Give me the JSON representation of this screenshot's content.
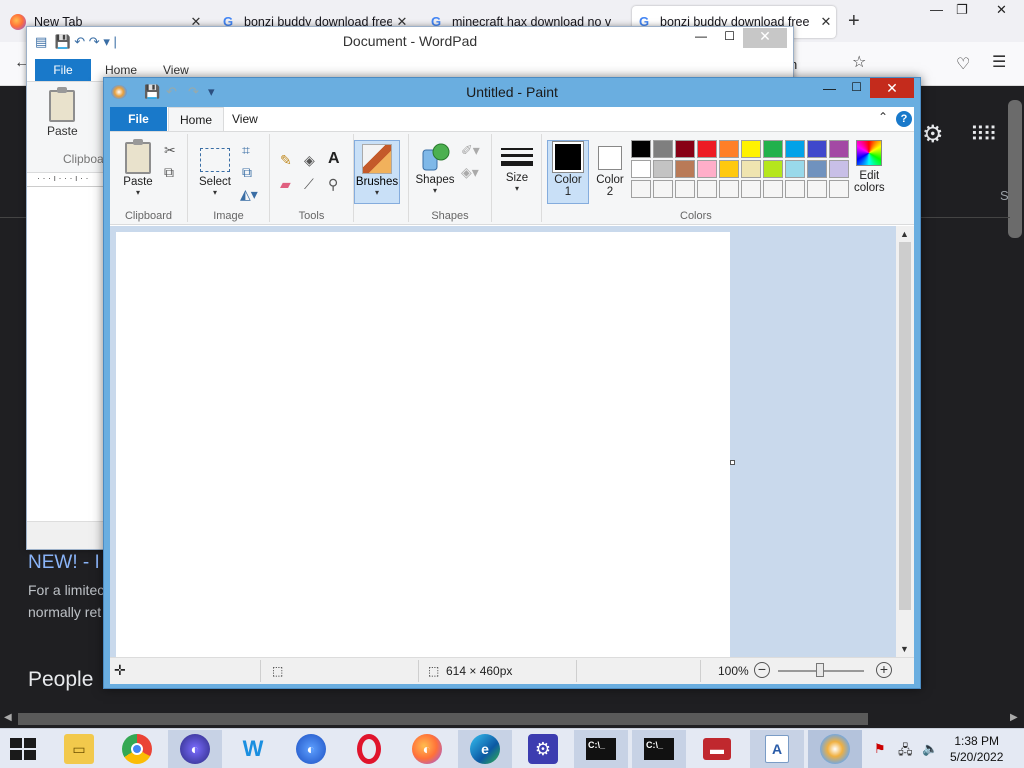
{
  "browser": {
    "tabs": [
      {
        "title": "New Tab",
        "favicon": "firefox-icon"
      },
      {
        "title": "bonzi buddy download free - ",
        "favicon": "google-icon"
      },
      {
        "title": "minecraft hax download no v",
        "favicon": "google-icon"
      },
      {
        "title": "bonzi buddy download free",
        "favicon": "google-icon",
        "active": true
      }
    ],
    "url_tail": "n"
  },
  "webpage": {
    "headline": "NEW! - I",
    "body_line1": "For a limitec",
    "body_line2": "normally ret",
    "section": "People",
    "side_letter": "S"
  },
  "wordpad": {
    "title": "Document - WordPad",
    "file_tab": "File",
    "home_tab": "Home",
    "view_tab": "View",
    "paste_label": "Paste",
    "clipboard_label": "Clipboa"
  },
  "paint": {
    "title": "Untitled - Paint",
    "tabs": {
      "file": "File",
      "home": "Home",
      "view": "View"
    },
    "ribbon": {
      "paste": "Paste",
      "clipboard_group": "Clipboard",
      "select": "Select",
      "image_group": "Image",
      "tools_group": "Tools",
      "brushes": "Brushes",
      "shapes": "Shapes",
      "shapes_group": "Shapes",
      "size": "Size",
      "color1_line1": "Color",
      "color1_line2": "1",
      "color2_line1": "Color",
      "color2_line2": "2",
      "edit_colors_line1": "Edit",
      "edit_colors_line2": "colors",
      "colors_group": "Colors"
    },
    "palette": [
      "#000000",
      "#7f7f7f",
      "#880015",
      "#ed1c24",
      "#ff7f27",
      "#fff200",
      "#22b14c",
      "#00a2e8",
      "#3f48cc",
      "#a349a4",
      "#ffffff",
      "#c3c3c3",
      "#b97a57",
      "#ffaec9",
      "#ffc90e",
      "#efe4b0",
      "#b5e61d",
      "#99d9ea",
      "#7092be",
      "#c8bfe7",
      "#f5f5f5",
      "#f5f5f5",
      "#f5f5f5",
      "#f5f5f5",
      "#f5f5f5",
      "#f5f5f5",
      "#f5f5f5",
      "#f5f5f5",
      "#f5f5f5",
      "#f5f5f5"
    ],
    "status": {
      "canvas_size": "614 × 460px",
      "zoom": "100%"
    }
  },
  "taskbar": {
    "time": "1:38 PM",
    "date": "5/20/2022",
    "items": [
      "file-explorer",
      "chrome",
      "firefox-nightly",
      "wunderlist",
      "firefox-dev",
      "opera",
      "firefox",
      "edge",
      "settings",
      "cmd",
      "cmd",
      "toolbox",
      "wordpad",
      "paint"
    ]
  }
}
